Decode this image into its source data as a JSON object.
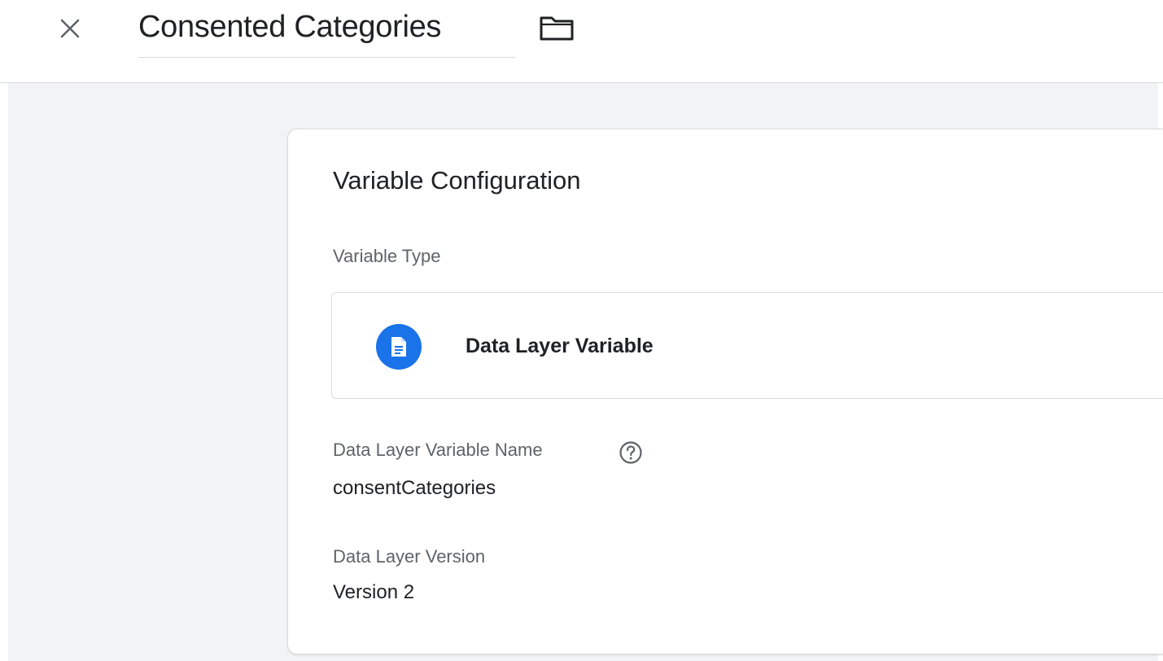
{
  "header": {
    "close_icon": "close-icon",
    "title": "Consented Categories",
    "folder_icon": "folder-icon"
  },
  "card": {
    "title": "Variable Configuration",
    "variable_type_label": "Variable Type",
    "variable_type": {
      "icon": "document-icon",
      "icon_color": "#1a73e8",
      "name": "Data Layer Variable"
    },
    "dlv_name_label": "Data Layer Variable Name",
    "help_icon": "help-icon",
    "dlv_name_value": "consentCategories",
    "dlv_version_label": "Data Layer Version",
    "dlv_version_value": "Version 2"
  },
  "colors": {
    "background": "#f1f3f4",
    "accent": "#1a73e8",
    "text_primary": "#202124",
    "text_secondary": "#5f6368",
    "border": "#dadce0"
  }
}
